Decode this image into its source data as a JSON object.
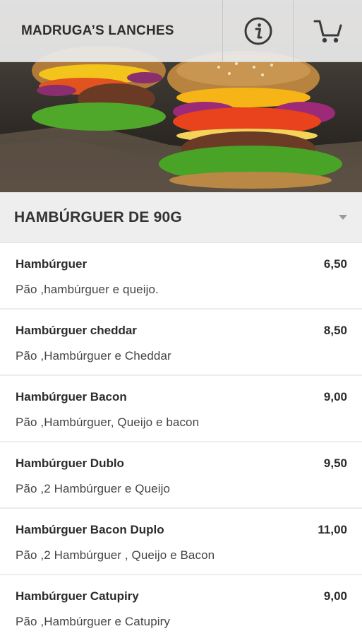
{
  "app": {
    "title": "MADRUGA’S LANCHES"
  },
  "toolbar": {
    "info_icon": "info-icon",
    "cart_icon": "cart-icon"
  },
  "hero": {
    "image": "burger-banner"
  },
  "category": {
    "title": "HAMBÚRGUER DE 90G",
    "toggle_icon": "chevron-down-icon"
  },
  "items": [
    {
      "name": "Hambúrguer",
      "price": "6,50",
      "description": "Pão ,hambúrguer e queijo."
    },
    {
      "name": "Hambúrguer cheddar",
      "price": "8,50",
      "description": "Pão ,Hambúrguer e Cheddar"
    },
    {
      "name": "Hambúrguer Bacon",
      "price": "9,00",
      "description": "Pão ,Hambúrguer, Queijo e bacon"
    },
    {
      "name": "Hambúrguer Dublo",
      "price": "9,50",
      "description": "Pão ,2 Hambúrguer e Queijo"
    },
    {
      "name": "Hambúrguer Bacon Duplo",
      "price": "11,00",
      "description": "Pão ,2 Hambúrguer , Queijo e Bacon"
    },
    {
      "name": "Hambúrguer Catupiry",
      "price": "9,00",
      "description": "Pão ,Hambúrguer e Catupiry"
    }
  ],
  "colors": {
    "topbar": "#ebebeb",
    "category_bg": "#eeeeee",
    "text": "#2c2c2c"
  }
}
